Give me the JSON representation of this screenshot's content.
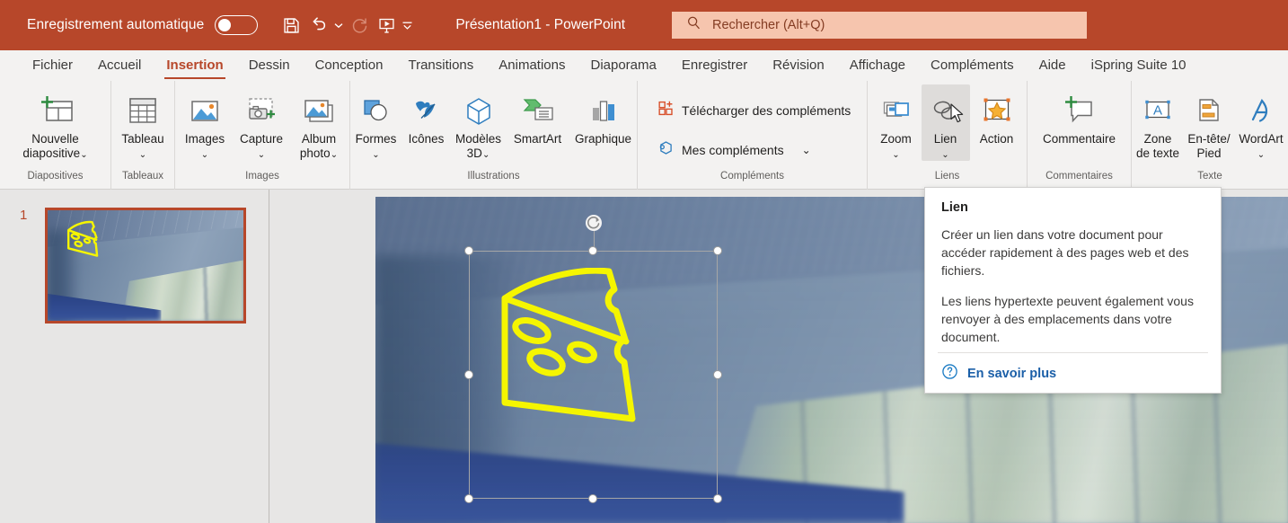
{
  "titlebar": {
    "autosave_label": "Enregistrement automatique",
    "autosave_state": "off",
    "doc_title": "Présentation1  -  PowerPoint",
    "qat": [
      {
        "name": "save-icon",
        "label": "Enregistrer"
      },
      {
        "name": "undo-icon",
        "label": "Annuler"
      },
      {
        "name": "undo-dropdown-icon",
        "label": "Options d'annulation"
      },
      {
        "name": "redo-icon",
        "label": "Rétablir"
      },
      {
        "name": "present-icon",
        "label": "Démarrer le diaporama"
      },
      {
        "name": "customize-qat-icon",
        "label": "Personnaliser la barre d'outils"
      }
    ],
    "background_color": "#B7472A"
  },
  "search": {
    "placeholder": "Rechercher (Alt+Q)",
    "icon": "search-icon",
    "background_color": "#F6C5AE"
  },
  "tabs": {
    "active": "Insertion",
    "items": [
      "Fichier",
      "Accueil",
      "Insertion",
      "Dessin",
      "Conception",
      "Transitions",
      "Animations",
      "Diaporama",
      "Enregistrer",
      "Révision",
      "Affichage",
      "Compléments",
      "Aide",
      "iSpring Suite 10"
    ]
  },
  "ribbon": {
    "groups": [
      {
        "label": "Diapositives",
        "buttons": [
          {
            "id": "new-slide",
            "label": "Nouvelle\ndiapositive",
            "icon": "new-slide-icon",
            "dropdown": true
          }
        ]
      },
      {
        "label": "Tableaux",
        "buttons": [
          {
            "id": "table",
            "label": "Tableau",
            "icon": "table-icon",
            "dropdown": true
          }
        ]
      },
      {
        "label": "Images",
        "buttons": [
          {
            "id": "images",
            "label": "Images",
            "icon": "pictures-icon",
            "dropdown": true
          },
          {
            "id": "screenshot",
            "label": "Capture",
            "icon": "screenshot-icon",
            "dropdown": true
          },
          {
            "id": "photo-album",
            "label": "Album\nphoto",
            "icon": "photo-album-icon",
            "dropdown": true
          }
        ]
      },
      {
        "label": "Illustrations",
        "buttons": [
          {
            "id": "shapes",
            "label": "Formes",
            "icon": "shapes-icon",
            "dropdown": true
          },
          {
            "id": "icons",
            "label": "Icônes",
            "icon": "icons-icon",
            "dropdown": false
          },
          {
            "id": "models-3d",
            "label": "Modèles\n3D",
            "icon": "model-3d-icon",
            "dropdown": true
          },
          {
            "id": "smartart",
            "label": "SmartArt",
            "icon": "smartart-icon",
            "dropdown": false
          },
          {
            "id": "chart",
            "label": "Graphique",
            "icon": "chart-icon",
            "dropdown": false
          }
        ]
      },
      {
        "label": "Compléments",
        "small_buttons": [
          {
            "id": "get-addins",
            "label": "Télécharger des compléments",
            "icon": "get-addins-icon",
            "dropdown": false
          },
          {
            "id": "my-addins",
            "label": "Mes compléments",
            "icon": "my-addins-icon",
            "dropdown": true
          }
        ]
      },
      {
        "label": "Liens",
        "buttons": [
          {
            "id": "zoom",
            "label": "Zoom",
            "icon": "zoom-icon",
            "dropdown": true
          },
          {
            "id": "link",
            "label": "Lien",
            "icon": "link-icon",
            "dropdown": true,
            "hovered": true
          },
          {
            "id": "action",
            "label": "Action",
            "icon": "action-icon",
            "dropdown": false
          }
        ]
      },
      {
        "label": "Commentaires",
        "buttons": [
          {
            "id": "comment",
            "label": "Commentaire",
            "icon": "new-comment-icon",
            "dropdown": false
          }
        ]
      },
      {
        "label": "Texte",
        "buttons": [
          {
            "id": "text-box",
            "label": "Zone\nde texte",
            "icon": "text-box-icon",
            "dropdown": false
          },
          {
            "id": "header-footer",
            "label": "En-tête/\nPied",
            "icon": "header-footer-icon",
            "dropdown": false
          },
          {
            "id": "wordart",
            "label": "WordArt",
            "icon": "wordart-icon",
            "dropdown": true
          }
        ]
      }
    ]
  },
  "thumbnails": {
    "slides": [
      {
        "number": "1",
        "selected": true,
        "alt": "Couloir vitré avec icône de fromage jaune"
      }
    ]
  },
  "slide": {
    "selected_object": "cheese-icon-graphic",
    "handles": 8,
    "rotate_handle": true
  },
  "tooltip": {
    "title": "Lien",
    "paragraph1": "Créer un lien dans votre document pour accéder rapidement à des pages web et des fichiers.",
    "paragraph2": "Les liens hypertexte peuvent également vous renvoyer à des emplacements dans votre document.",
    "link_label": "En savoir plus",
    "link_icon": "help-circle-icon",
    "link_color": "#1B5FA8"
  },
  "colors": {
    "theme_accent": "#B7472A",
    "ribbon_bg": "#F3F2F1",
    "workspace_bg": "#E7E6E5",
    "icon_yellow": "#F5F500"
  }
}
